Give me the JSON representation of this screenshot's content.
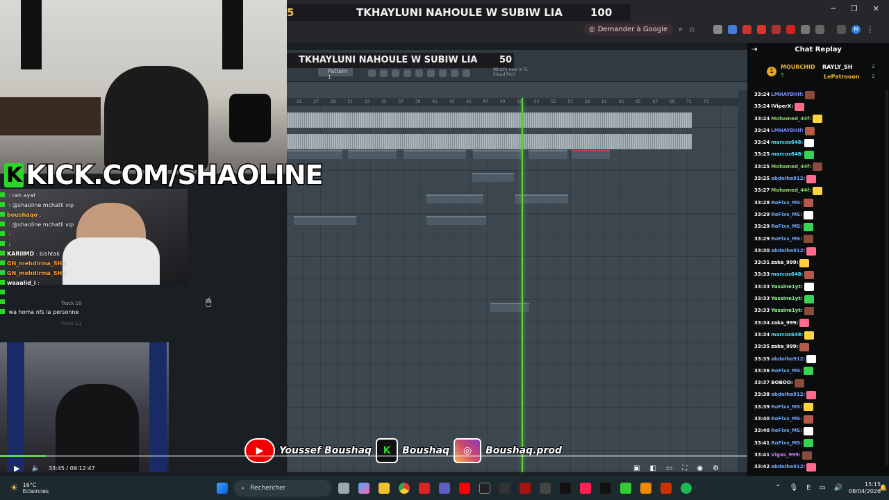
{
  "browser": {
    "banner_title": "TKHAYLUNI NAHOULE W SUBIW LIA",
    "banner_left_number": "5",
    "banner_right_number": "100",
    "google_chip_label": "Demander à Google",
    "avatar_letter": "M"
  },
  "daw": {
    "title": "TKHAYLUNI NAHOULE W SUBIW LIA",
    "title_number": "50",
    "pattern_label": "Pattern 1",
    "cloud_line1": "What's new in FL",
    "cloud_line2": "Cloud Pro?",
    "ruler_ticks": [
      "25",
      "27",
      "29",
      "31",
      "33",
      "35",
      "37",
      "39",
      "41",
      "43",
      "45",
      "47",
      "49",
      "51",
      "53",
      "55",
      "57",
      "59",
      "61",
      "63",
      "65",
      "67",
      "69",
      "71",
      "73"
    ],
    "track_label": "Track 10",
    "track_label_2": "Track 11"
  },
  "stream": {
    "overlay_text": "KICK.COM/SHAOLINE",
    "overlay_k": "K",
    "chat_overlay": [
      {
        "user": "",
        "text": ": rah ayat"
      },
      {
        "user": "",
        "text": ": @shaoline mchatli vip"
      },
      {
        "user": "boushaqo",
        "text": ":"
      },
      {
        "user": "",
        "text": ": @shaoline mchatli vip"
      },
      {
        "user": "",
        "text": ":"
      },
      {
        "user": "",
        "text": ":"
      },
      {
        "user": "KARIIMD",
        "text": ": bishtak"
      },
      {
        "user": "GN_mehdirma_SH",
        "text": ":"
      },
      {
        "user": "GN_mehdirma_SH",
        "text": ":"
      },
      {
        "user": "waaalid_i",
        "text": ":"
      },
      {
        "user": "",
        "text": ""
      },
      {
        "user": "",
        "text": ""
      },
      {
        "user": "",
        "text": "wa homa nfs la personne"
      }
    ],
    "social_youtube": "Youssef Boushaq",
    "social_kick": "Boushaq",
    "social_instagram": "Boushaq.prod",
    "time_current": "33:45",
    "time_total": "09:12:47",
    "time_display": "33:45 / 09:12:47",
    "progress_fraction": 0.061
  },
  "chat_replay": {
    "header": "Chat Replay",
    "leader_1": "MOURCHID",
    "leader_1_count": "5",
    "leader_2": "RAYLY_SH",
    "leader_2_count": "2",
    "leader_3": "LePatrooon",
    "leader_3_count": "2",
    "messages": [
      {
        "ts": "33:24",
        "user": "LMHAYDIIIf:",
        "color": "#7b8cff"
      },
      {
        "ts": "33:24",
        "user": "IViperX:",
        "color": "#ffffff"
      },
      {
        "ts": "33:24",
        "user": "Mohamed_44f:",
        "color": "#8fd36e"
      },
      {
        "ts": "33:24",
        "user": "LMHAYDIIIf:",
        "color": "#7b8cff"
      },
      {
        "ts": "33:24",
        "user": "marcos648:",
        "color": "#52e3ff"
      },
      {
        "ts": "33:25",
        "user": "marcos648:",
        "color": "#52e3ff"
      },
      {
        "ts": "33:25",
        "user": "Mohamed_44f:",
        "color": "#8fd36e"
      },
      {
        "ts": "33:25",
        "user": "abdolha912:",
        "color": "#6fa8ff"
      },
      {
        "ts": "33:27",
        "user": "Mohamed_44f:",
        "color": "#8fd36e"
      },
      {
        "ts": "33:28",
        "user": "RoFixx_MS:",
        "color": "#6fa8ff"
      },
      {
        "ts": "33:29",
        "user": "RoFixx_MS:",
        "color": "#6fa8ff"
      },
      {
        "ts": "33:29",
        "user": "RoFixx_MS:",
        "color": "#6fa8ff"
      },
      {
        "ts": "33:29",
        "user": "RoFixx_MS:",
        "color": "#6fa8ff"
      },
      {
        "ts": "33:30",
        "user": "abdolha912:",
        "color": "#6fa8ff"
      },
      {
        "ts": "33:31",
        "user": "zaka_999:",
        "color": "#ffffff"
      },
      {
        "ts": "33:33",
        "user": "marcos648:",
        "color": "#52e3ff"
      },
      {
        "ts": "33:33",
        "user": "Yassine1yt:",
        "color": "#8fff8f"
      },
      {
        "ts": "33:33",
        "user": "Yassine1yt:",
        "color": "#8fff8f"
      },
      {
        "ts": "33:33",
        "user": "Yassine1yt:",
        "color": "#8fff8f"
      },
      {
        "ts": "33:34",
        "user": "zaka_999:",
        "color": "#ffffff"
      },
      {
        "ts": "33:34",
        "user": "marcos648:",
        "color": "#52e3ff"
      },
      {
        "ts": "33:35",
        "user": "zaka_999:",
        "color": "#ffffff"
      },
      {
        "ts": "33:35",
        "user": "abdolha912:",
        "color": "#6fa8ff"
      },
      {
        "ts": "33:36",
        "user": "RoFixx_MS:",
        "color": "#6fa8ff"
      },
      {
        "ts": "33:37",
        "user": "BOBOO:",
        "color": "#ffffff"
      },
      {
        "ts": "33:38",
        "user": "abdolha912:",
        "color": "#6fa8ff"
      },
      {
        "ts": "33:39",
        "user": "RoFixx_MS:",
        "color": "#6fa8ff"
      },
      {
        "ts": "33:40",
        "user": "RoFixx_MS:",
        "color": "#6fa8ff"
      },
      {
        "ts": "33:40",
        "user": "RoFixx_MS:",
        "color": "#6fa8ff"
      },
      {
        "ts": "33:41",
        "user": "RoFixx_MS:",
        "color": "#6fa8ff"
      },
      {
        "ts": "33:41",
        "user": "Vigas_999:",
        "color": "#d57bff"
      },
      {
        "ts": "33:42",
        "user": "abdolha912:",
        "color": "#6fa8ff"
      }
    ]
  },
  "taskbar": {
    "weather_temp": "16°C",
    "weather_desc": "Eclaircies",
    "search_placeholder": "Rechercher",
    "lang": "E",
    "time": "15:15",
    "date": "08/04/2026"
  },
  "colors": {
    "accent_green": "#61d24a",
    "kick_green": "#2bd62b",
    "youtube_red": "#ff0000"
  }
}
